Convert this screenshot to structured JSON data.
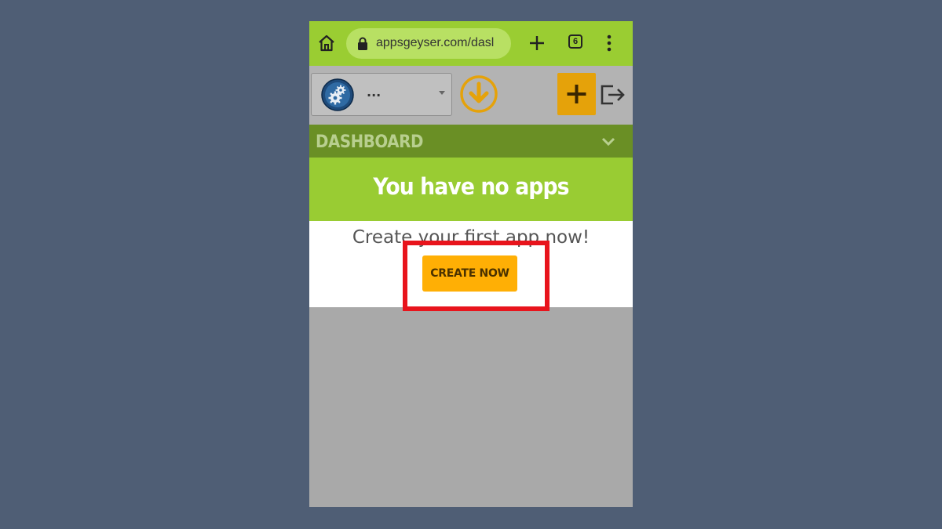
{
  "browser": {
    "url": "appsgeyser.com/dasl",
    "tab_count": "6",
    "icons": [
      "home-icon",
      "lock-icon",
      "plus-icon",
      "tabs-icon",
      "menu-icon"
    ]
  },
  "toolbar": {
    "app_select_value": "...",
    "icons": [
      "gear-icon",
      "download-icon",
      "plus-icon",
      "logout-icon"
    ]
  },
  "dashboard": {
    "title": "DASHBOARD"
  },
  "empty_state": {
    "title": "You have no apps",
    "subtitle": "Create your first app now!",
    "create_button_label": "CREATE NOW"
  },
  "colors": {
    "browser_bar": "#9acd32",
    "dashboard_bar": "#6a8f25",
    "empty_header": "#99cc33",
    "accent_orange": "#ffaf05",
    "highlight_red": "#e8141c"
  }
}
